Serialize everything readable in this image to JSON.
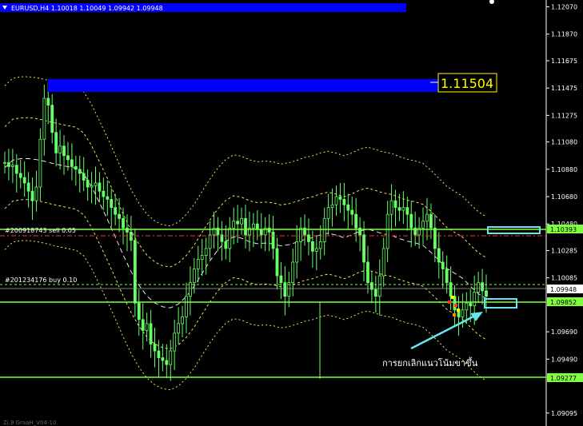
{
  "window": {
    "symbol_header": "EURUSD,H4  1.10018 1.10049 1.09942 1.09948",
    "menu_arrow_icon": "triangle-down-icon",
    "footer_label": "Zi.9 GraaH_V04-10"
  },
  "price_axis": {
    "ticks": [
      "1.12070",
      "1.11870",
      "1.11675",
      "1.11475",
      "1.11275",
      "1.11080",
      "1.10880",
      "1.10680",
      "1.10480",
      "1.10285",
      "1.10085",
      "1.09690",
      "1.09490",
      "1.09095"
    ],
    "labels": {
      "resistance": "1.10393",
      "current": "1.09948",
      "support_near": "1.09852",
      "support_low": "1.09277"
    }
  },
  "big_price_box": "1.11504",
  "orders": [
    {
      "label": "#200918743 sell 0.05"
    },
    {
      "label": "#201234176 buy 0.10"
    }
  ],
  "annotation": {
    "text": "การยกเลิกแนวโน้มขาขึ้น"
  },
  "colors": {
    "background": "#000000",
    "candle": "#66ff66",
    "level_line": "#80ff40",
    "highlight_bar": "#0000ff",
    "annotation": "#66e6f0",
    "envelope": "#ffff66",
    "sell_line": "#ff3333"
  },
  "chart_data": {
    "type": "candlestick",
    "symbol": "EURUSD",
    "timeframe": "H4",
    "ohlc_last": {
      "open": 1.10018,
      "high": 1.10049,
      "low": 1.09942,
      "close": 1.09948
    },
    "ylim": [
      1.09,
      1.1212
    ],
    "levels": [
      1.10393,
      1.09852,
      1.09277,
      1.11504
    ],
    "close_series": [
      1.1093,
      1.109,
      1.1091,
      1.1085,
      1.1082,
      1.1078,
      1.1072,
      1.1065,
      1.1075,
      1.111,
      1.114,
      1.1135,
      1.1115,
      1.11,
      1.1105,
      1.1098,
      1.1095,
      1.109,
      1.1088,
      1.1085,
      1.108,
      1.1075,
      1.1076,
      1.1078,
      1.1072,
      1.1068,
      1.1066,
      1.106,
      1.1055,
      1.1052,
      1.1045,
      1.1042,
      1.1036,
      1.099,
      1.0978,
      1.097,
      1.0975,
      1.096,
      1.0955,
      1.095,
      1.0948,
      1.0945,
      1.0955,
      1.0968,
      1.0975,
      1.098,
      1.0995,
      1.1005,
      1.1015,
      1.1022,
      1.1025,
      1.103,
      1.104,
      1.1045,
      1.104,
      1.1035,
      1.103,
      1.1045,
      1.105,
      1.1048,
      1.1052,
      1.104,
      1.1045,
      1.1048,
      1.1044,
      1.104,
      1.1045,
      1.1042,
      1.103,
      1.101,
      1.1005,
      1.0995,
      1.1005,
      1.102,
      1.1035,
      1.1045,
      1.104,
      1.1035,
      1.1028,
      1.103,
      1.1035,
      1.1052,
      1.106,
      1.1062,
      1.1068,
      1.1066,
      1.1062,
      1.1058,
      1.1055,
      1.1045,
      1.104,
      1.102,
      1.1005,
      1.1,
      1.0995,
      1.101,
      1.103,
      1.1055,
      1.1065,
      1.106,
      1.1058,
      1.106,
      1.1055,
      1.1045,
      1.104,
      1.1045,
      1.105,
      1.1055,
      1.1045,
      1.103,
      1.102,
      1.1015,
      1.1005,
      1.0995,
      1.0985,
      1.098,
      1.0985,
      1.099,
      1.0988,
      1.0998,
      1.1005,
      1.0999,
      1.0995
    ]
  }
}
